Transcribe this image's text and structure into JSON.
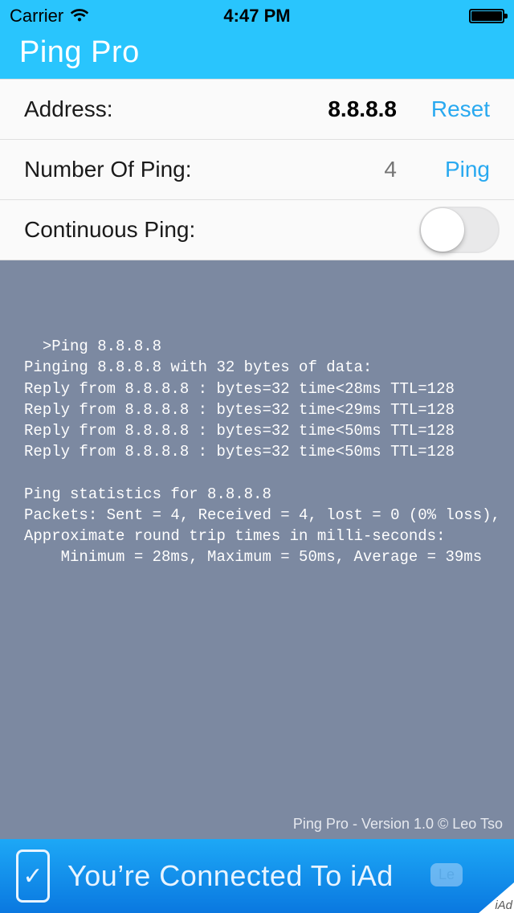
{
  "status_bar": {
    "carrier": "Carrier",
    "time": "4:47 PM"
  },
  "nav": {
    "title": "Ping Pro"
  },
  "form": {
    "address_label": "Address:",
    "address_value": "8.8.8.8",
    "reset_label": "Reset",
    "count_label": "Number Of Ping:",
    "count_placeholder": "4",
    "ping_label": "Ping",
    "continuous_label": "Continuous Ping:",
    "continuous_on": false
  },
  "console": {
    "text": ">Ping 8.8.8.8\nPinging 8.8.8.8 with 32 bytes of data:\nReply from 8.8.8.8 : bytes=32 time<28ms TTL=128\nReply from 8.8.8.8 : bytes=32 time<29ms TTL=128\nReply from 8.8.8.8 : bytes=32 time<50ms TTL=128\nReply from 8.8.8.8 : bytes=32 time<50ms TTL=128\n\nPing statistics for 8.8.8.8\nPackets: Sent = 4, Received = 4, lost = 0 (0% loss),\nApproximate round trip times in milli-seconds:\n    Minimum = 28ms, Maximum = 50ms, Average = 39ms",
    "footer": "Ping Pro - Version 1.0 © Leo Tso"
  },
  "iad": {
    "text": "You’re Connected To iAd",
    "button": "Le",
    "corner": "iAd"
  }
}
